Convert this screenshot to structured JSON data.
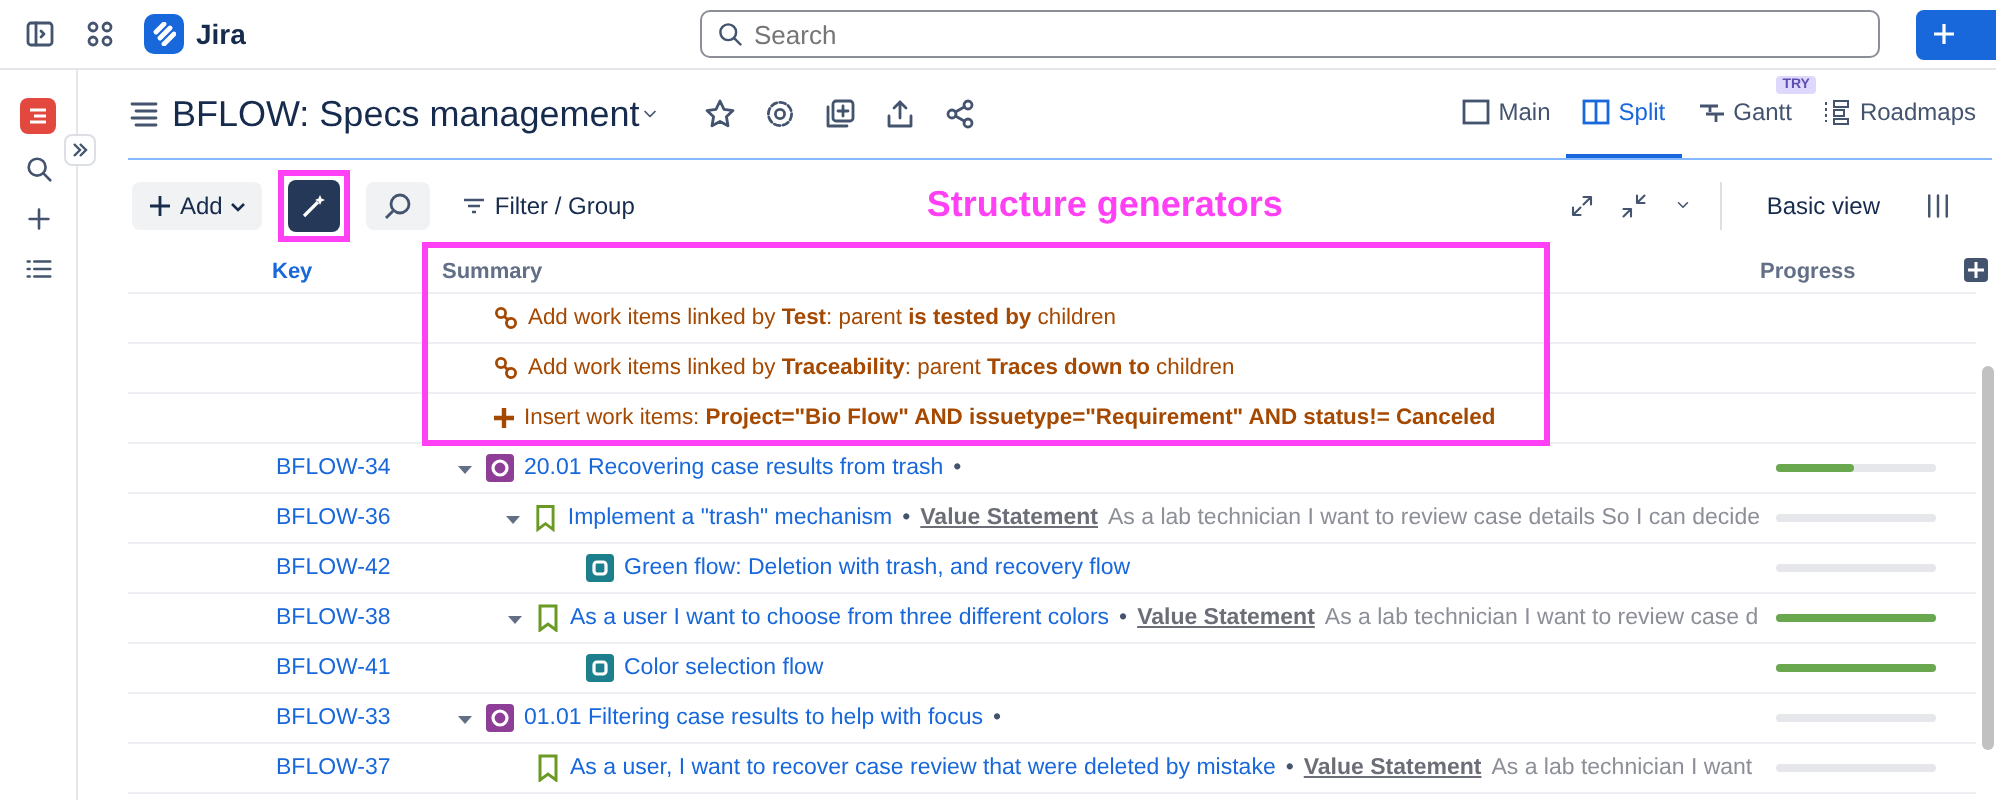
{
  "topbar": {
    "product": "Jira",
    "search": {
      "placeholder": "Search"
    }
  },
  "page": {
    "title": "BFLOW: Specs management",
    "tabs": [
      {
        "label": "Main",
        "selected": false,
        "kind": "main"
      },
      {
        "label": "Split",
        "selected": true,
        "kind": "split"
      },
      {
        "label": "Gantt",
        "selected": false,
        "kind": "gantt",
        "badge": "TRY"
      },
      {
        "label": "Roadmaps",
        "selected": false,
        "kind": "roadmaps"
      }
    ]
  },
  "toolbar": {
    "add": "Add",
    "generators_active": true,
    "filter": "Filter / Group",
    "view": "Basic view"
  },
  "annotation": {
    "label": "Structure generators"
  },
  "table": {
    "columns": [
      "Key",
      "Summary",
      "Progress"
    ],
    "generators": [
      {
        "kind": "link",
        "text": "Add work items linked by **Test**: parent **is tested by** children"
      },
      {
        "kind": "link",
        "text": "Add work items linked by **Traceability**: parent **Traces down to** children"
      },
      {
        "kind": "insert",
        "text": "Insert work items: **Project=\"Bio Flow\" AND issuetype=\"Requirement\" AND status!= Canceled**"
      }
    ],
    "rows": [
      {
        "key": "BFLOW-34",
        "kind": "epic",
        "separator": "•",
        "summary": "20.01 Recovering case results from trash",
        "expanded": true,
        "level": 0.49,
        "children": [
          {
            "key": "BFLOW-36",
            "kind": "story",
            "separator": "•",
            "summary": "Implement a \"trash\" mechanism",
            "field": "Value Statement",
            "description": "As a lab technician I want to review case details So I can decide",
            "expanded": true,
            "level": 0,
            "children": [
              {
                "key": "BFLOW-42",
                "kind": "subtask",
                "summary": "Green flow: Deletion with trash, and recovery flow",
                "level": 0
              }
            ]
          },
          {
            "key": "BFLOW-38",
            "kind": "story",
            "separator": "•",
            "summary": "As a user I want to choose from three different colors",
            "field": "Value Statement",
            "description": "As a lab technician I want to review case d",
            "expanded": true,
            "level": 1,
            "children": [
              {
                "key": "BFLOW-41",
                "kind": "subtask",
                "summary": "Color selection flow",
                "level": 1
              }
            ]
          }
        ]
      },
      {
        "key": "BFLOW-33",
        "kind": "epic",
        "separator": "•",
        "summary": "01.01 Filtering case results to help with focus",
        "expanded": true,
        "level": 0,
        "children": [
          {
            "key": "BFLOW-37",
            "kind": "story",
            "separator": "•",
            "summary": "As a user, I want to recover case review that were deleted by mistake",
            "field": "Value Statement",
            "description": "As a lab technician I want",
            "level": 0
          }
        ]
      }
    ]
  }
}
